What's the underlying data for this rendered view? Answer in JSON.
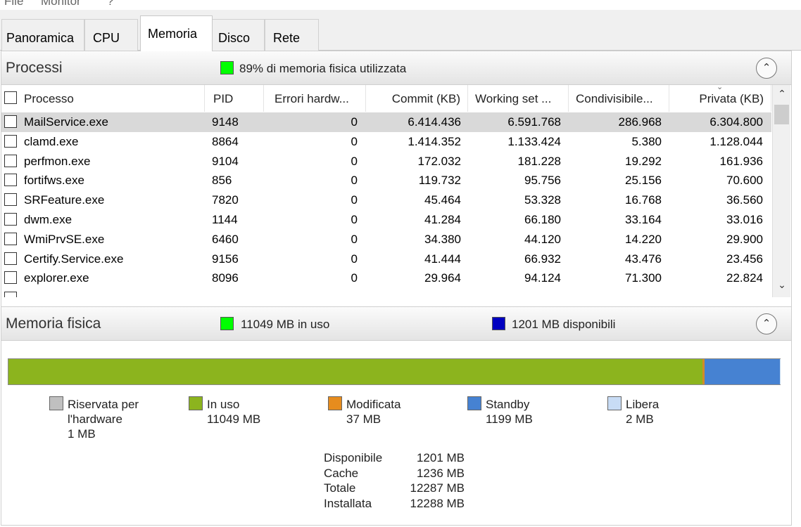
{
  "menu": [
    "File",
    "Monitor",
    "?"
  ],
  "tabs": [
    "Panoramica",
    "CPU",
    "Memoria",
    "Disco",
    "Rete"
  ],
  "active_tab": "Memoria",
  "processes": {
    "title": "Processi",
    "usage_text": "89% di memoria fisica utilizzata",
    "usage_color": "#00ff00",
    "columns": [
      "Processo",
      "PID",
      "Errori hardw...",
      "Commit (KB)",
      "Working set ...",
      "Condivisibile...",
      "Privata (KB)"
    ],
    "rows": [
      {
        "name": "MailService.exe",
        "pid": "9148",
        "faults": "0",
        "commit": "6.414.436",
        "ws": "6.591.768",
        "shared": "286.968",
        "private": "6.304.800"
      },
      {
        "name": "clamd.exe",
        "pid": "8864",
        "faults": "0",
        "commit": "1.414.352",
        "ws": "1.133.424",
        "shared": "5.380",
        "private": "1.128.044"
      },
      {
        "name": "perfmon.exe",
        "pid": "9104",
        "faults": "0",
        "commit": "172.032",
        "ws": "181.228",
        "shared": "19.292",
        "private": "161.936"
      },
      {
        "name": "fortifws.exe",
        "pid": "856",
        "faults": "0",
        "commit": "119.732",
        "ws": "95.756",
        "shared": "25.156",
        "private": "70.600"
      },
      {
        "name": "SRFeature.exe",
        "pid": "7820",
        "faults": "0",
        "commit": "45.464",
        "ws": "53.328",
        "shared": "16.768",
        "private": "36.560"
      },
      {
        "name": "dwm.exe",
        "pid": "1144",
        "faults": "0",
        "commit": "41.284",
        "ws": "66.180",
        "shared": "33.164",
        "private": "33.016"
      },
      {
        "name": "WmiPrvSE.exe",
        "pid": "6460",
        "faults": "0",
        "commit": "34.380",
        "ws": "44.120",
        "shared": "14.220",
        "private": "29.900"
      },
      {
        "name": "Certify.Service.exe",
        "pid": "9156",
        "faults": "0",
        "commit": "41.444",
        "ws": "66.932",
        "shared": "43.476",
        "private": "23.456"
      },
      {
        "name": "explorer.exe",
        "pid": "8096",
        "faults": "0",
        "commit": "29.964",
        "ws": "94.124",
        "shared": "71.300",
        "private": "22.824"
      }
    ]
  },
  "physical": {
    "title": "Memoria fisica",
    "in_use_text": "11049 MB in uso",
    "in_use_color": "#00ff00",
    "available_text": "1201 MB disponibili",
    "available_color": "#0000c0",
    "bar": [
      {
        "name": "reserved",
        "mb": 1,
        "color": "#b4b4b4"
      },
      {
        "name": "in-use",
        "mb": 11049,
        "color": "#8cb41e"
      },
      {
        "name": "modified",
        "mb": 37,
        "color": "#d28c28"
      },
      {
        "name": "standby",
        "mb": 1199,
        "color": "#4682d2"
      },
      {
        "name": "free",
        "mb": 2,
        "color": "#c8dcf0"
      }
    ],
    "legend": [
      {
        "label1": "Riservata per",
        "label2": "l'hardware",
        "label3": "1 MB",
        "color": "#c0c0c0"
      },
      {
        "label1": "In uso",
        "label2": "11049 MB",
        "color": "#8cb41e"
      },
      {
        "label1": "Modificata",
        "label2": "37 MB",
        "color": "#e68c1e"
      },
      {
        "label1": "Standby",
        "label2": "1199 MB",
        "color": "#4682d2"
      },
      {
        "label1": "Libera",
        "label2": "2 MB",
        "color": "#c8dcf5"
      }
    ],
    "stats": [
      {
        "label": "Disponibile",
        "value": "1201 MB"
      },
      {
        "label": "Cache",
        "value": "1236 MB"
      },
      {
        "label": "Totale",
        "value": "12287 MB"
      },
      {
        "label": "Installata",
        "value": "12288 MB"
      }
    ]
  }
}
